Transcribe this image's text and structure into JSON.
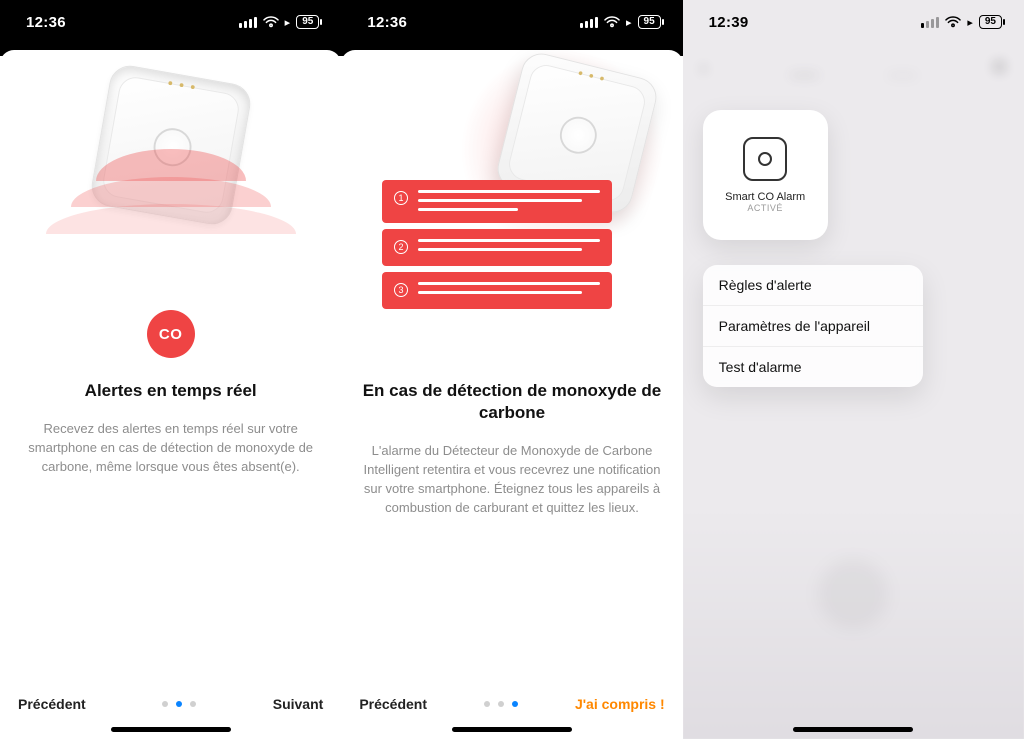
{
  "statusbar": {
    "time_a": "12:36",
    "time_b": "12:36",
    "time_c": "12:39",
    "battery": "95"
  },
  "screen1": {
    "co_label": "CO",
    "title": "Alertes en temps réel",
    "desc": "Recevez des alertes en temps réel sur votre smartphone en cas de détection de monoxyde de carbone, même lorsque vous êtes absent(e).",
    "prev": "Précédent",
    "next": "Suivant",
    "active_dot": 1
  },
  "screen2": {
    "title": "En cas de détection de monoxyde de carbone",
    "desc": "L'alarme du Détecteur de Monoxyde de Carbone Intelligent retentira et vous recevrez une notification sur votre smartphone. Éteignez tous les appareils à combustion de carburant et quittez les lieux.",
    "prev": "Précédent",
    "done": "J'ai compris !",
    "active_dot": 2
  },
  "screen3": {
    "tile_name": "Smart CO Alarm",
    "tile_state": "ACTIVÉ",
    "menu": {
      "alert_rules": "Règles d'alerte",
      "device_settings": "Paramètres de l'appareil",
      "alarm_test": "Test d'alarme"
    }
  }
}
